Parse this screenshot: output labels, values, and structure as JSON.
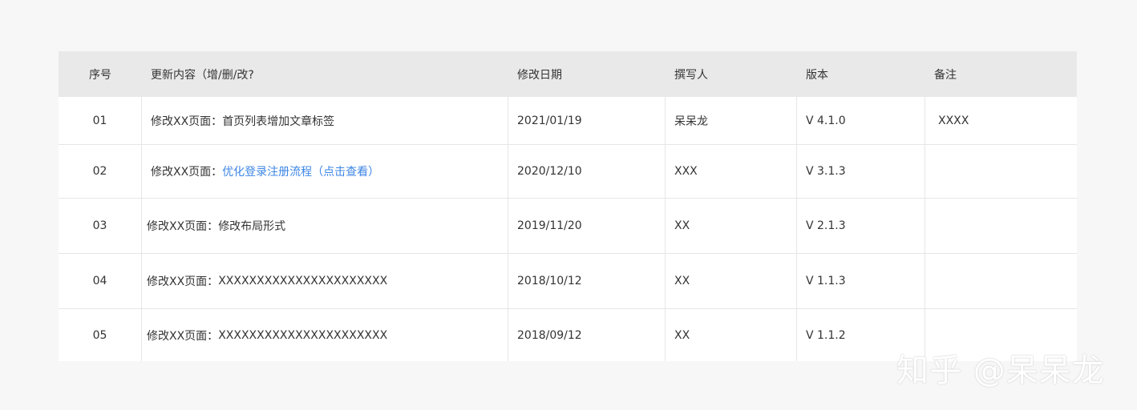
{
  "table": {
    "headers": [
      "序号",
      "更新内容（增/删/改?",
      "修改日期",
      "撰写人",
      "版本",
      "备注"
    ],
    "rows": [
      {
        "index": "01",
        "content_prefix": "修改XX页面：",
        "content_text": "首页列表增加文章标签",
        "content_link": "",
        "date": "2021/01/19",
        "author": "呆呆龙",
        "version": "V 4.1.0",
        "remark": "XXXX"
      },
      {
        "index": "02",
        "content_prefix": "修改XX页面：",
        "content_text": "",
        "content_link": "优化登录注册流程（点击查看）",
        "date": "2020/12/10",
        "author": "XXX",
        "version": "V 3.1.3",
        "remark": ""
      },
      {
        "index": "03",
        "content_prefix": "修改XX页面：",
        "content_text": "修改布局形式",
        "content_link": "",
        "date": "2019/11/20",
        "author": "XX",
        "version": "V 2.1.3",
        "remark": ""
      },
      {
        "index": "04",
        "content_prefix": "修改XX页面：",
        "content_text": "XXXXXXXXXXXXXXXXXXXXXX",
        "content_link": "",
        "date": "2018/10/12",
        "author": "XX",
        "version": "V 1.1.3",
        "remark": ""
      },
      {
        "index": "05",
        "content_prefix": "修改XX页面：",
        "content_text": "XXXXXXXXXXXXXXXXXXXXXX",
        "content_link": "",
        "date": "2018/09/12",
        "author": "XX",
        "version": "V 1.1.2",
        "remark": ""
      }
    ]
  },
  "colors": {
    "link": "#3d86e6",
    "header_bg": "#e9e9e9",
    "page_bg": "#f7f7f7"
  },
  "watermark": "知乎 @呆呆龙"
}
